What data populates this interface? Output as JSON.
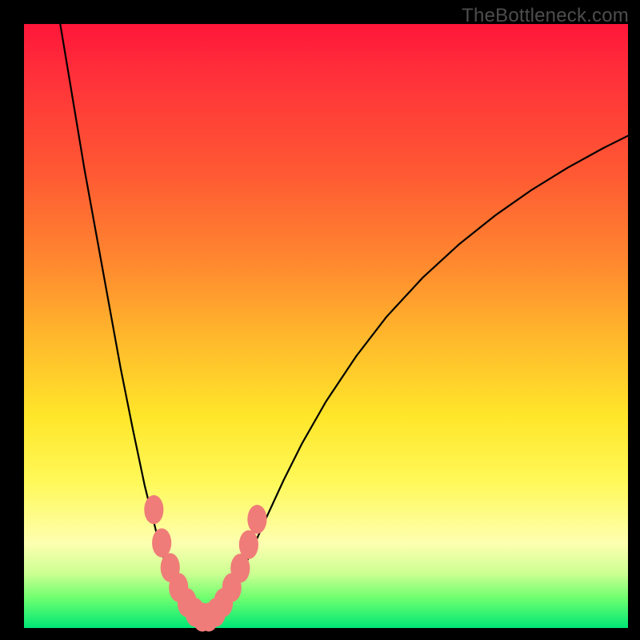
{
  "watermark": "TheBottleneck.com",
  "colors": {
    "frame": "#000000",
    "bead": "#ef7c78",
    "curve": "#000000",
    "gradient_top": "#ff163a",
    "gradient_bottom": "#00e676"
  },
  "chart_data": {
    "type": "line",
    "title": "",
    "xlabel": "",
    "ylabel": "",
    "xlim": [
      0,
      100
    ],
    "ylim": [
      0,
      100
    ],
    "grid": false,
    "legend": null,
    "note": "Axes are unlabeled in the source image; values below are relative to a 0–100 coordinate space where (0,0) is the top-left of the plot area. Curve values are estimated from pixel positions.",
    "curve_points_xy": [
      [
        6,
        0
      ],
      [
        8,
        12
      ],
      [
        10,
        24
      ],
      [
        12,
        35
      ],
      [
        14,
        46
      ],
      [
        16,
        57
      ],
      [
        18,
        67
      ],
      [
        20,
        76.5
      ],
      [
        22,
        84.5
      ],
      [
        23,
        88
      ],
      [
        24,
        91
      ],
      [
        25,
        93.5
      ],
      [
        26,
        95.5
      ],
      [
        27,
        97
      ],
      [
        28,
        98
      ],
      [
        29,
        98.7
      ],
      [
        30,
        99
      ],
      [
        31,
        98.7
      ],
      [
        32,
        98
      ],
      [
        33,
        96.7
      ],
      [
        34,
        95
      ],
      [
        36,
        91
      ],
      [
        38,
        86.5
      ],
      [
        40,
        82
      ],
      [
        43,
        75.5
      ],
      [
        46,
        69.5
      ],
      [
        50,
        62.5
      ],
      [
        55,
        55
      ],
      [
        60,
        48.5
      ],
      [
        66,
        42
      ],
      [
        72,
        36.5
      ],
      [
        78,
        31.7
      ],
      [
        84,
        27.5
      ],
      [
        90,
        23.8
      ],
      [
        96,
        20.5
      ],
      [
        100,
        18.5
      ]
    ],
    "beads_on_curve_xy": [
      [
        21.5,
        80.4
      ],
      [
        22.8,
        85.9
      ],
      [
        24.2,
        90.0
      ],
      [
        25.6,
        93.3
      ],
      [
        27.0,
        95.8
      ],
      [
        28.3,
        97.4
      ],
      [
        29.5,
        98.2
      ],
      [
        30.6,
        98.2
      ],
      [
        31.8,
        97.4
      ],
      [
        33.0,
        95.8
      ],
      [
        34.4,
        93.3
      ],
      [
        35.8,
        90.1
      ],
      [
        37.2,
        86.2
      ],
      [
        38.6,
        82.0
      ]
    ],
    "bead_rx": 1.6,
    "bead_ry": 2.4
  }
}
